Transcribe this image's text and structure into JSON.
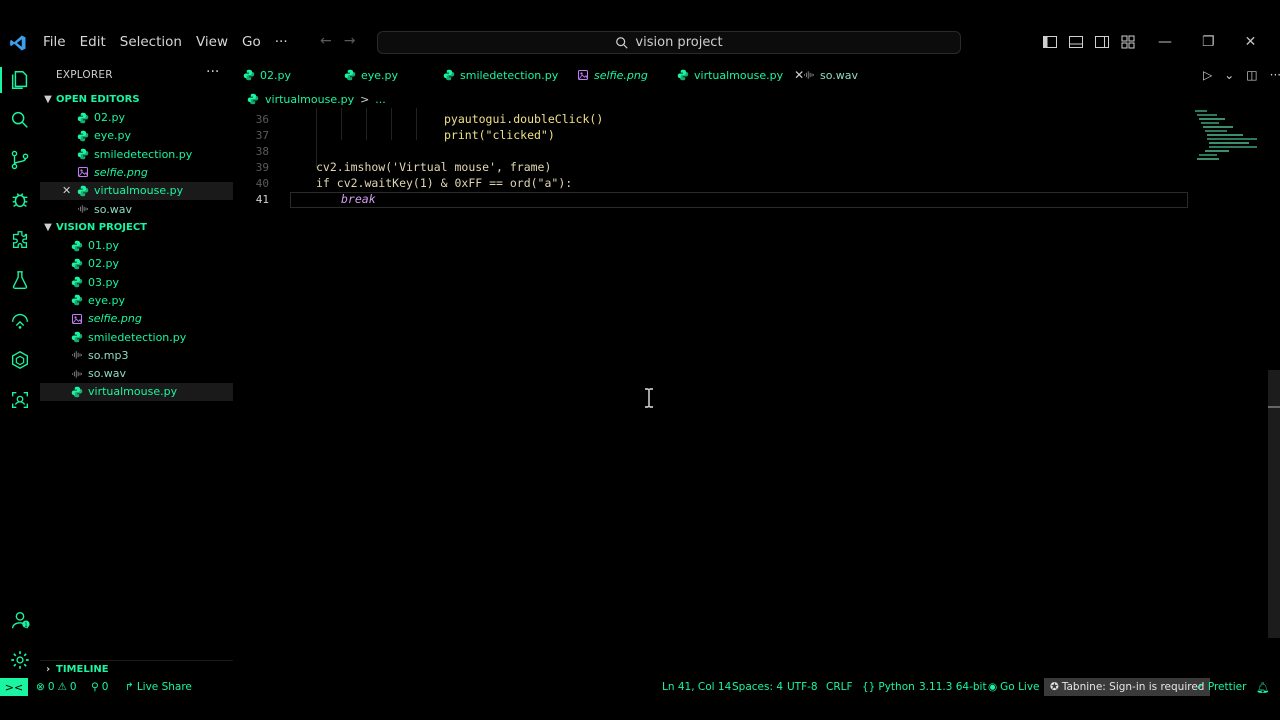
{
  "menubar": {
    "items": [
      "File",
      "Edit",
      "Selection",
      "View",
      "Go"
    ],
    "more": "···",
    "search_text": "vision project"
  },
  "sidebar": {
    "title": "EXPLORER",
    "more": "···",
    "open_editors": {
      "label": "OPEN EDITORS",
      "files": [
        {
          "name": "02.py",
          "type": "py"
        },
        {
          "name": "eye.py",
          "type": "py"
        },
        {
          "name": "smiledetection.py",
          "type": "py"
        },
        {
          "name": "selfie.png",
          "type": "png"
        },
        {
          "name": "virtualmouse.py",
          "type": "py",
          "selected": true
        },
        {
          "name": "so.wav",
          "type": "audio"
        }
      ]
    },
    "project": {
      "label": "VISION PROJECT",
      "files": [
        {
          "name": "01.py",
          "type": "py"
        },
        {
          "name": "02.py",
          "type": "py"
        },
        {
          "name": "03.py",
          "type": "py"
        },
        {
          "name": "eye.py",
          "type": "py"
        },
        {
          "name": "selfie.png",
          "type": "png"
        },
        {
          "name": "smiledetection.py",
          "type": "py"
        },
        {
          "name": "so.mp3",
          "type": "audio"
        },
        {
          "name": "so.wav",
          "type": "audio"
        },
        {
          "name": "virtualmouse.py",
          "type": "py",
          "selected": true
        }
      ]
    },
    "timeline_label": "TIMELINE"
  },
  "tabs": [
    {
      "label": "02.py",
      "type": "py"
    },
    {
      "label": "eye.py",
      "type": "py"
    },
    {
      "label": "smiledetection.py",
      "type": "py"
    },
    {
      "label": "selfie.png",
      "type": "png"
    },
    {
      "label": "virtualmouse.py",
      "type": "py",
      "active": true
    },
    {
      "label": "so.wav",
      "type": "audio"
    }
  ],
  "breadcrumb": {
    "file": "virtualmouse.py",
    "sep": ">",
    "more": "..."
  },
  "editor": {
    "lines": [
      {
        "num": "36",
        "code": "pyautogui.doubleClick()"
      },
      {
        "num": "37",
        "code": "print(\"clicked\")"
      },
      {
        "num": "38",
        "code": ""
      },
      {
        "num": "39",
        "code": "cv2.imshow('Virtual mouse', frame)"
      },
      {
        "num": "40",
        "code": "if cv2.waitKey(1) & 0xFF == ord(\"a\"):"
      },
      {
        "num": "41",
        "code": "break"
      }
    ]
  },
  "statusbar": {
    "remote": "><",
    "errors": "0",
    "warnings": "0",
    "ports": "0",
    "live_share": "Live Share",
    "position": "Ln 41, Col 14",
    "spaces": "Spaces: 4",
    "encoding": "UTF-8",
    "eol": "CRLF",
    "language": "Python",
    "interpreter": "3.11.3 64-bit",
    "go_live": "Go Live",
    "tabnine": "Tabnine: Sign-in is required",
    "prettier": "Prettier"
  },
  "colors": {
    "accent": "#19f5a0",
    "background": "#000000"
  }
}
